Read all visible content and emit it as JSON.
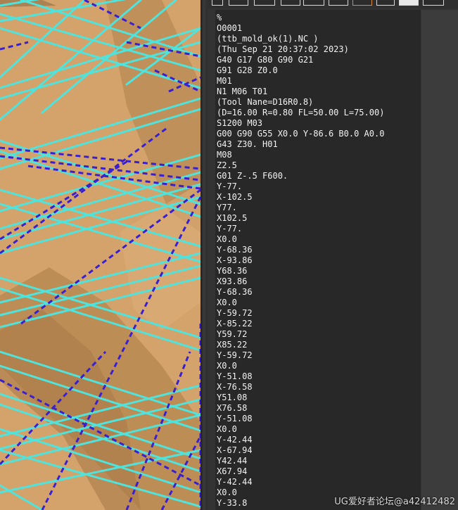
{
  "viewport": {
    "name": "3d-toolpath-viewport",
    "colors": {
      "surface": "#d4a36c",
      "shadow": "#b78a55",
      "feed_path": "#4fe0da",
      "rapid_path": "#3a1fd0"
    }
  },
  "toolbar": {
    "icons": [
      "open-file-icon",
      "save-icon",
      "search-icon",
      "copy-icon",
      "paste-icon",
      "cut-icon",
      "bracket-icon",
      "compare-icon",
      "image-icon",
      "add-icon"
    ]
  },
  "editor": {
    "lines": [
      "%",
      "O0001",
      "(ttb_mold_ok(1).NC )",
      "(Thu Sep 21 20:37:02 2023)",
      "G40 G17 G80 G90 G21",
      "G91 G28 Z0.0",
      "M01",
      "N1 M06 T01",
      "(Tool Nane=D16R0.8)",
      "(D=16.00 R=0.80 FL=50.00 L=75.00)",
      "S1200 M03",
      "G00 G90 G55 X0.0 Y-86.6 B0.0 A0.0",
      "G43 Z30. H01",
      "M08",
      "Z2.5",
      "G01 Z-.5 F600.",
      "Y-77.",
      "X-102.5",
      "Y77.",
      "X102.5",
      "Y-77.",
      "X0.0",
      "Y-68.36",
      "X-93.86",
      "Y68.36",
      "X93.86",
      "Y-68.36",
      "X0.0",
      "Y-59.72",
      "X-85.22",
      "Y59.72",
      "X85.22",
      "Y-59.72",
      "X0.0",
      "Y-51.08",
      "X-76.58",
      "Y51.08",
      "X76.58",
      "Y-51.08",
      "X0.0",
      "Y-42.44",
      "X-67.94",
      "Y42.44",
      "X67.94",
      "Y-42.44",
      "X0.0",
      "Y-33.8"
    ]
  },
  "watermark": "UG爱好者论坛@a42412482"
}
